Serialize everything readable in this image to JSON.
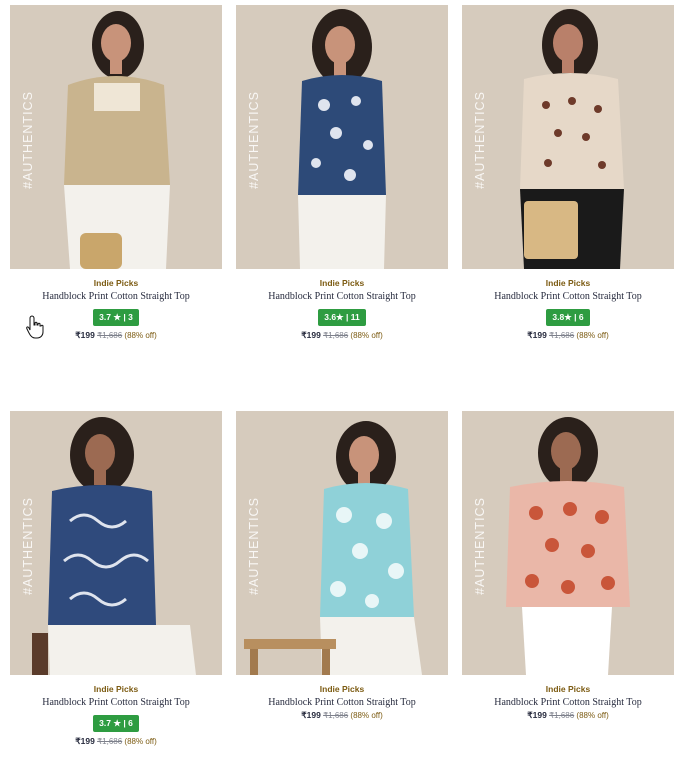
{
  "watermark": "#AUTHENTICS",
  "colors": {
    "rating_bg": "#2e9c41",
    "brand_text": "#7c5b12",
    "photo_bg": "#d3c7b8"
  },
  "products": [
    {
      "brand": "Indie Picks",
      "title": "Handblock Print Cotton Straight Top",
      "rating": "3.7 ★ | 3",
      "price": "₹199",
      "mrp": "₹1,686",
      "discount": "(88% off)",
      "top_color": "#c9b48e",
      "pant_color": "#f3f1ec"
    },
    {
      "brand": "Indie Picks",
      "title": "Handblock Print Cotton Straight Top",
      "rating": "3.6★ | 11",
      "price": "₹199",
      "mrp": "₹1,686",
      "discount": "(88% off)",
      "top_color": "#2d4a78",
      "pant_color": "#f3f1ec"
    },
    {
      "brand": "Indie Picks",
      "title": "Handblock Print Cotton Straight Top",
      "rating": "3.8★ | 6",
      "price": "₹199",
      "mrp": "₹1,686",
      "discount": "(88% off)",
      "top_color": "#e6d8c8",
      "pant_color": "#1a1a1a"
    },
    {
      "brand": "Indie Picks",
      "title": "Handblock Print Cotton Straight Top",
      "rating": "3.7 ★ | 6",
      "price": "₹199",
      "mrp": "₹1,686",
      "discount": "(88% off)",
      "top_color": "#2f4a7c",
      "pant_color": "#f3f1ec"
    },
    {
      "brand": "Indie Picks",
      "title": "Handblock Print Cotton Straight Top",
      "rating": "",
      "price": "₹199",
      "mrp": "₹1,686",
      "discount": "(88% off)",
      "top_color": "#8fd1d8",
      "pant_color": "#f3f1ec"
    },
    {
      "brand": "Indie Picks",
      "title": "Handblock Print Cotton Straight Top",
      "rating": "",
      "price": "₹199",
      "mrp": "₹1,686",
      "discount": "(88% off)",
      "top_color": "#eab7a8",
      "pant_color": "#ffffff"
    }
  ]
}
